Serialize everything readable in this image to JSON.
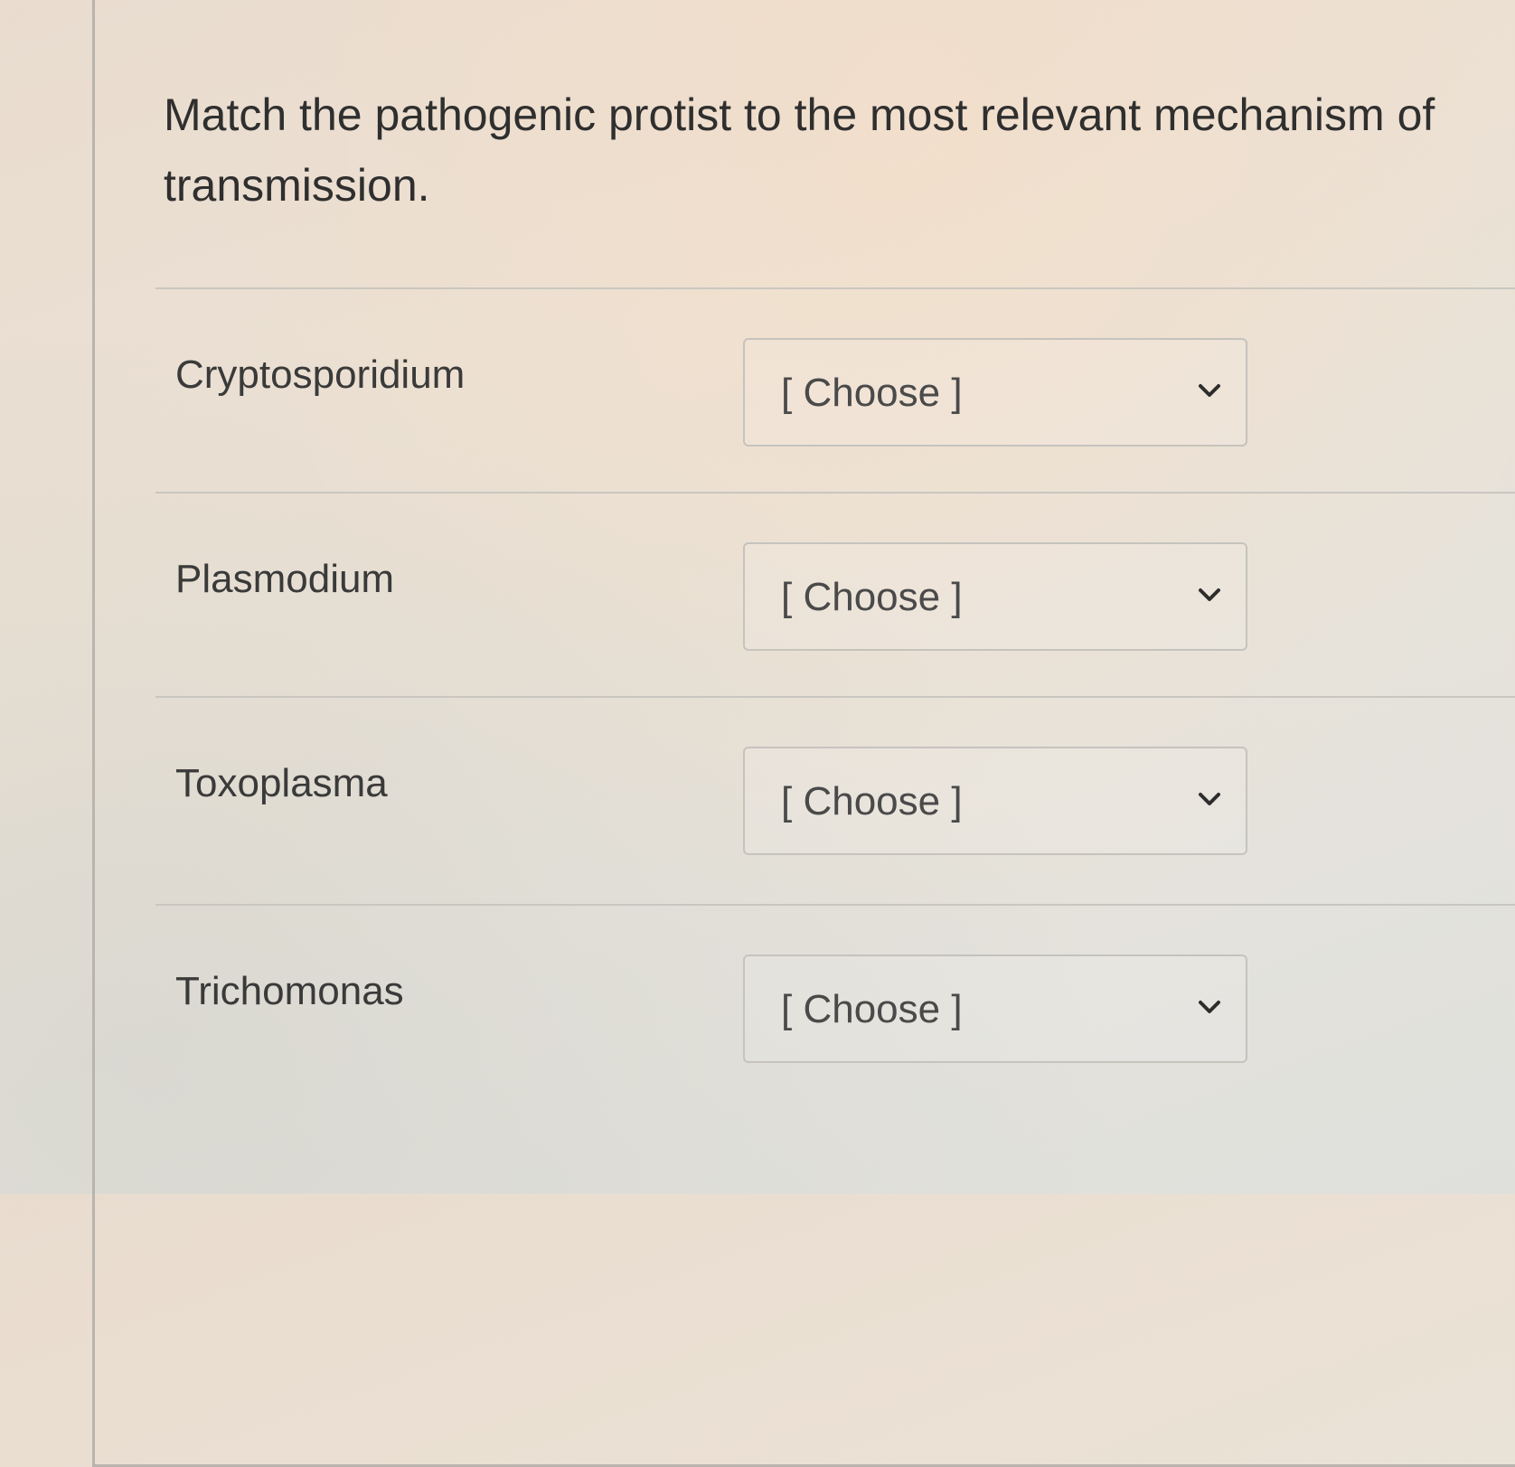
{
  "question": {
    "prompt": "Match the pathogenic protist to the most relevant mechanism of transmission."
  },
  "matches": [
    {
      "term": "Cryptosporidium",
      "selected": "[ Choose ]"
    },
    {
      "term": "Plasmodium",
      "selected": "[ Choose ]"
    },
    {
      "term": "Toxoplasma",
      "selected": "[ Choose ]"
    },
    {
      "term": "Trichomonas",
      "selected": "[ Choose ]"
    }
  ],
  "icons": {
    "dropdown": "chevron-down-icon"
  },
  "colors": {
    "text": "#3a3a3a",
    "border": "#c6c3bd"
  }
}
